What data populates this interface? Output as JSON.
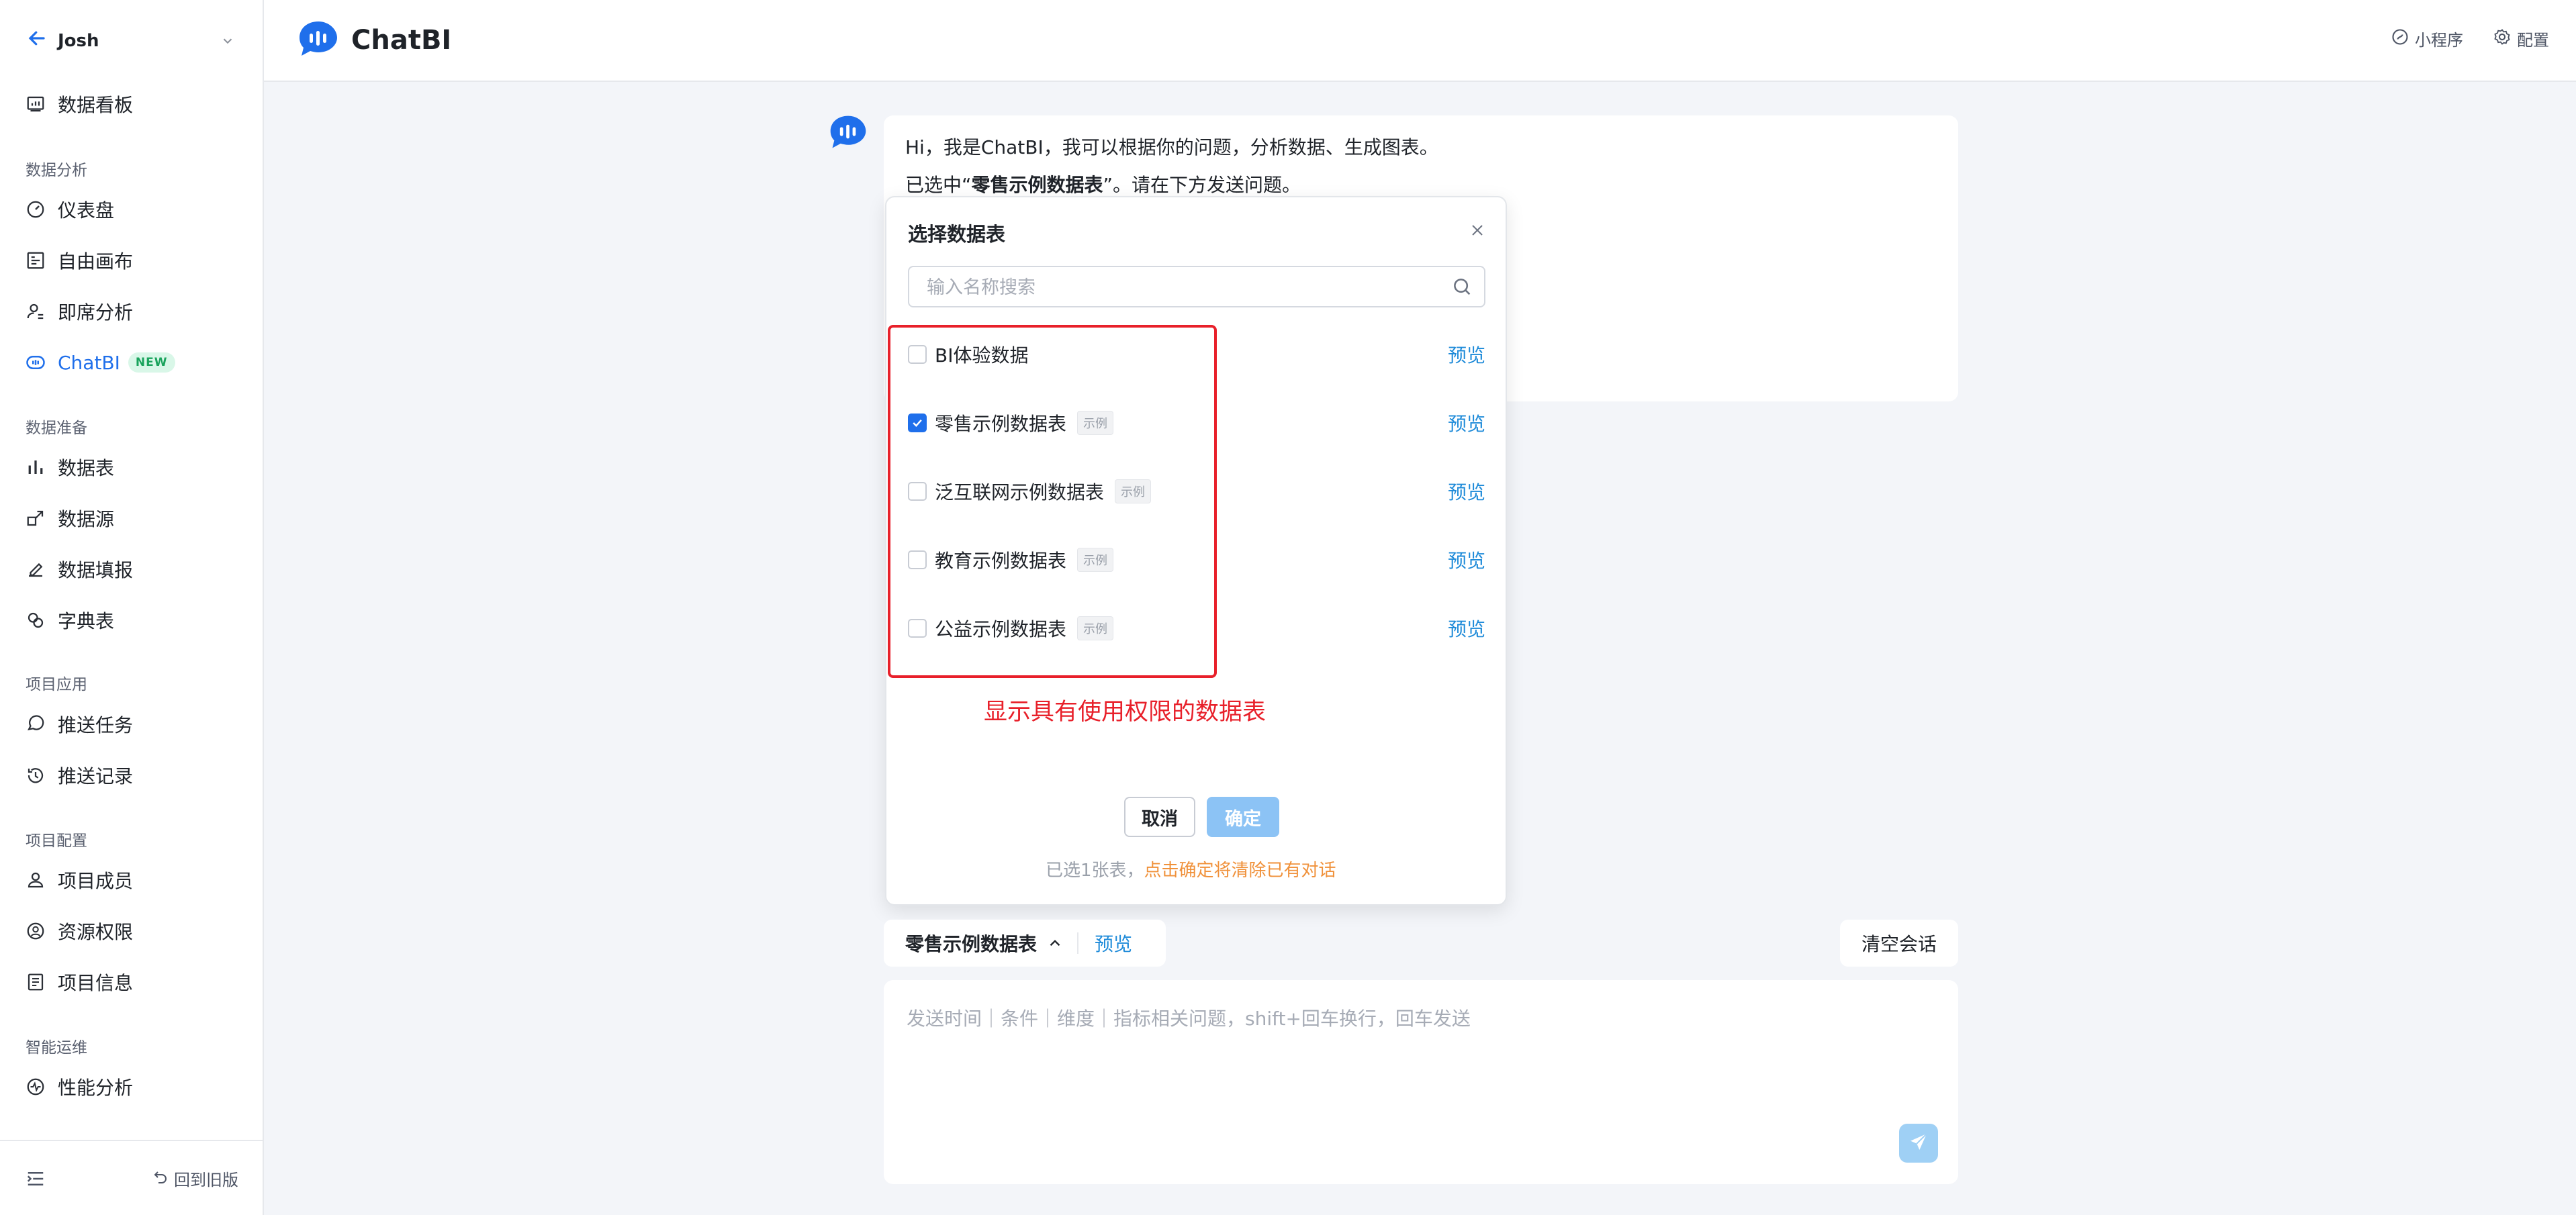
{
  "sidebar": {
    "user": "Josh",
    "dashboard": "数据看板",
    "sections": [
      {
        "title": "数据分析",
        "items": [
          "仪表盘",
          "自由画布",
          "即席分析",
          "ChatBI"
        ]
      },
      {
        "title": "数据准备",
        "items": [
          "数据表",
          "数据源",
          "数据填报",
          "字典表"
        ]
      },
      {
        "title": "项目应用",
        "items": [
          "推送任务",
          "推送记录"
        ]
      },
      {
        "title": "项目配置",
        "items": [
          "项目成员",
          "资源权限",
          "项目信息"
        ]
      },
      {
        "title": "智能运维",
        "items": [
          "性能分析"
        ]
      }
    ],
    "new_badge": "NEW",
    "active_item": "ChatBI",
    "footer_old_version": "回到旧版"
  },
  "header": {
    "brand": "ChatBI",
    "actions": [
      "小程序",
      "配置"
    ]
  },
  "chat": {
    "greeting": "Hi，我是ChatBI，我可以根据你的问题，分析数据、生成图表。",
    "selected_prefix": "已选中“",
    "selected_table": "零售示例数据表",
    "selected_suffix": "”。请在下方发送问题。"
  },
  "modal": {
    "title": "选择数据表",
    "search_placeholder": "输入名称搜索",
    "datasets": [
      {
        "name": "BI体验数据",
        "tag": "",
        "checked": false,
        "preview": "预览"
      },
      {
        "name": "零售示例数据表",
        "tag": "示例",
        "checked": true,
        "preview": "预览"
      },
      {
        "name": "泛互联网示例数据表",
        "tag": "示例",
        "checked": false,
        "preview": "预览"
      },
      {
        "name": "教育示例数据表",
        "tag": "示例",
        "checked": false,
        "preview": "预览"
      },
      {
        "name": "公益示例数据表",
        "tag": "示例",
        "checked": false,
        "preview": "预览"
      }
    ],
    "annotation": "显示具有使用权限的数据表",
    "cancel": "取消",
    "confirm": "确定",
    "selected_count": "已选1张表，",
    "warning": "点击确定将清除已有对话"
  },
  "composer": {
    "current_table": "零售示例数据表",
    "preview": "预览",
    "clear": "清空会话",
    "placeholder": "发送时间｜条件｜维度｜指标相关问题，shift+回车换行，回车发送"
  },
  "colors": {
    "accent": "#1f6feb",
    "link": "#1f8bd9",
    "annotation_red": "#e8202a",
    "warning_orange": "#f0913a",
    "new_badge_green": "#1aa35c"
  }
}
